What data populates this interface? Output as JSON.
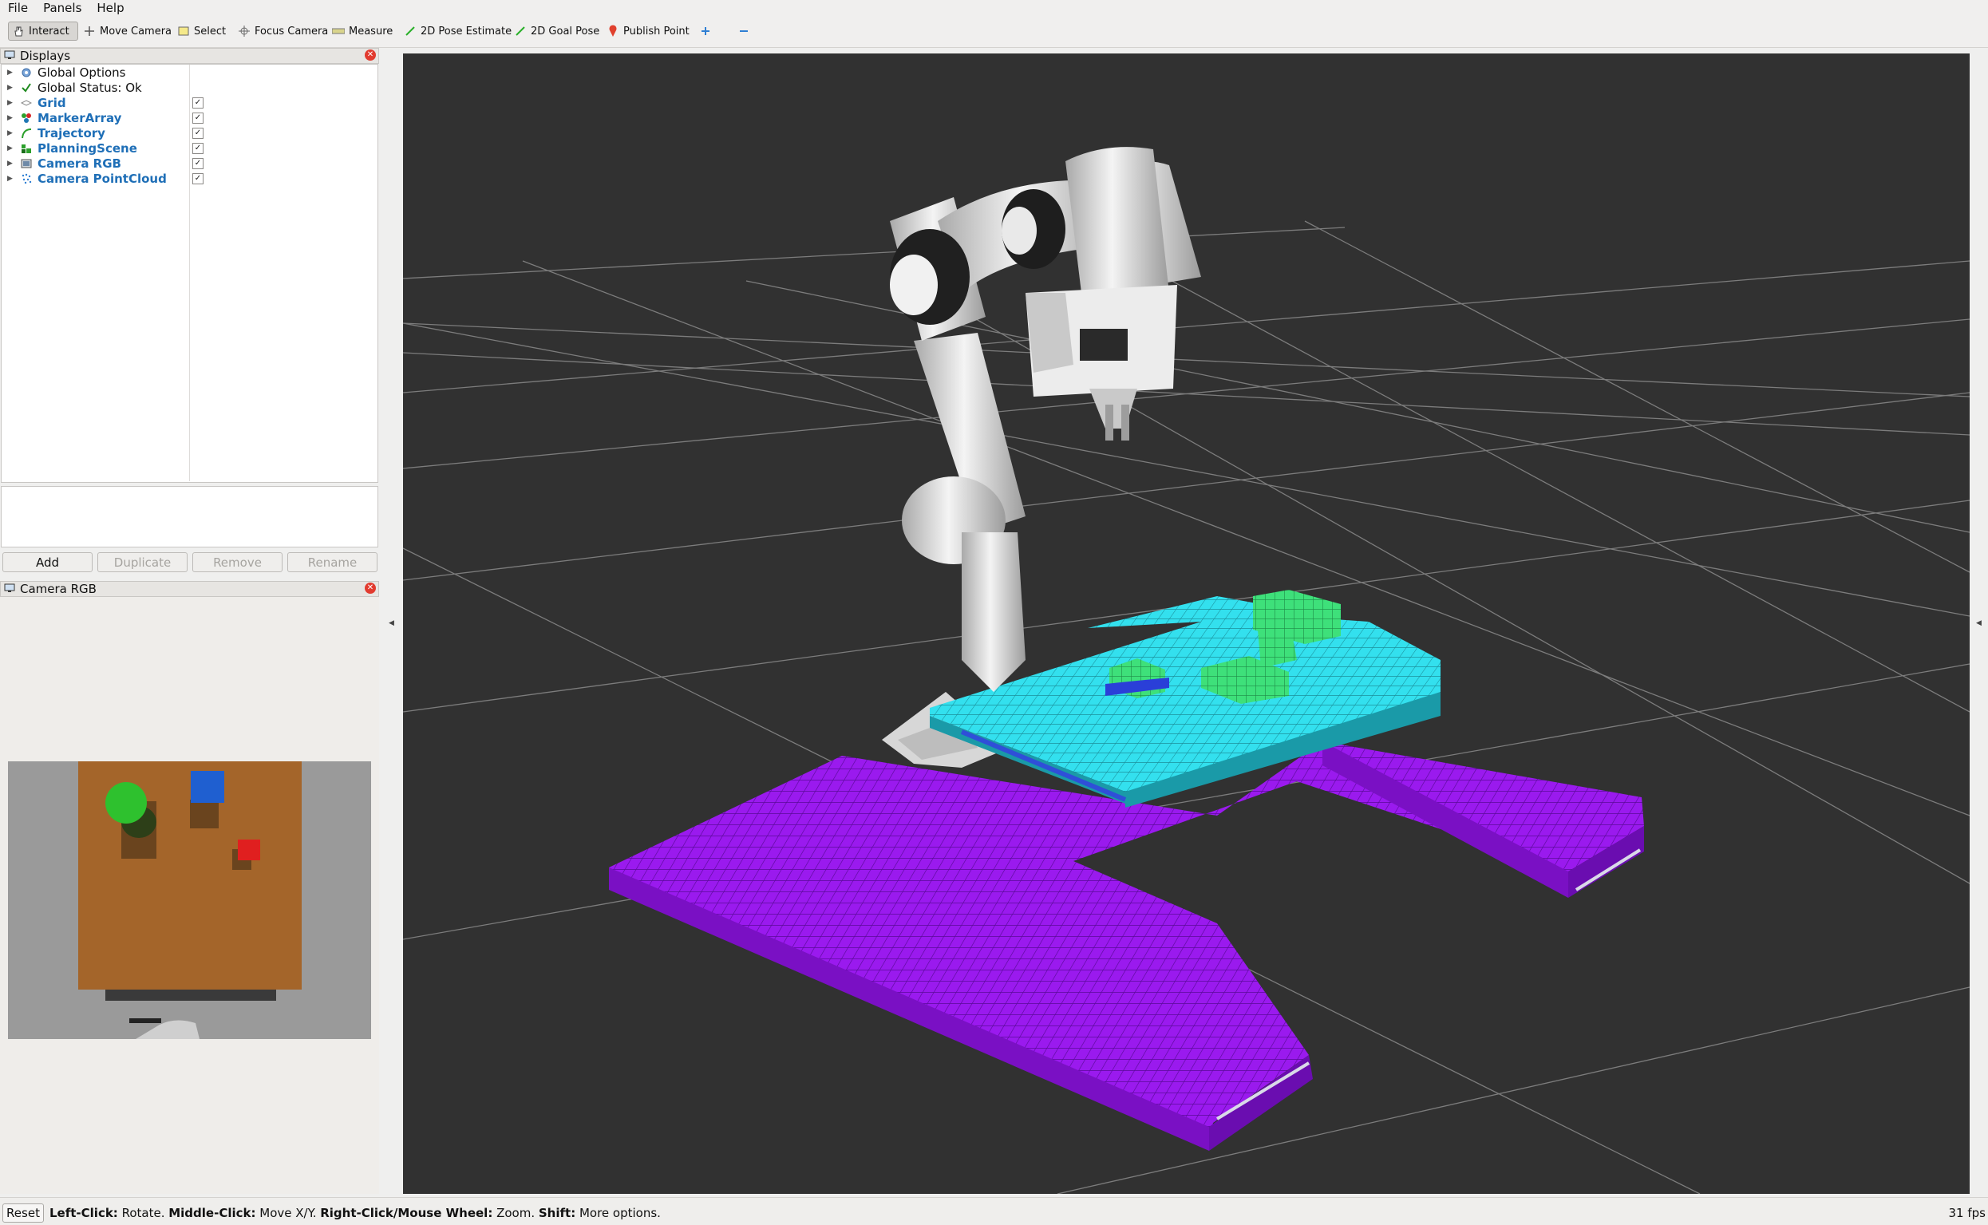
{
  "menu": {
    "file": {
      "label": "File"
    },
    "panels": {
      "label": "Panels"
    },
    "help": {
      "label": "Help"
    }
  },
  "toolbar": {
    "interact": "Interact",
    "move_camera": "Move Camera",
    "select": "Select",
    "focus_camera": "Focus Camera",
    "measure": "Measure",
    "pose_estimate": "2D Pose Estimate",
    "goal_pose": "2D Goal Pose",
    "publish_point": "Publish Point"
  },
  "displays": {
    "title": "Displays",
    "items": [
      {
        "label": "Global Options",
        "icon": "gear-icon",
        "checked": null
      },
      {
        "label": "Global Status: Ok",
        "icon": "check-icon",
        "checked": null
      },
      {
        "label": "Grid",
        "icon": "grid-icon",
        "checked": true
      },
      {
        "label": "MarkerArray",
        "icon": "marker-array-icon",
        "checked": true
      },
      {
        "label": "Trajectory",
        "icon": "trajectory-icon",
        "checked": true
      },
      {
        "label": "PlanningScene",
        "icon": "planning-scene-icon",
        "checked": true
      },
      {
        "label": "Camera RGB",
        "icon": "camera-icon",
        "checked": true
      },
      {
        "label": "Camera PointCloud",
        "icon": "pointcloud-icon",
        "checked": true
      }
    ],
    "check_mark": "✓"
  },
  "buttons": {
    "add": "Add",
    "duplicate": "Duplicate",
    "remove": "Remove",
    "rename": "Rename"
  },
  "camera_panel": {
    "title": "Camera RGB"
  },
  "colors": {
    "voxel_cyan": "#33e0ee",
    "voxel_purple": "#9a1aee",
    "voxel_green": "#3ee07a",
    "table_brown": "#a4652a",
    "viewport_bg": "#313131",
    "link_blue": "#1f6fb7"
  },
  "status": {
    "reset": "Reset",
    "hint_parts": [
      {
        "bold": "Left-Click:",
        "text": " Rotate. "
      },
      {
        "bold": "Middle-Click:",
        "text": " Move X/Y. "
      },
      {
        "bold": "Right-Click/Mouse Wheel:",
        "text": " Zoom. "
      },
      {
        "bold": "Shift:",
        "text": " More options."
      }
    ],
    "fps": "31 fps"
  }
}
